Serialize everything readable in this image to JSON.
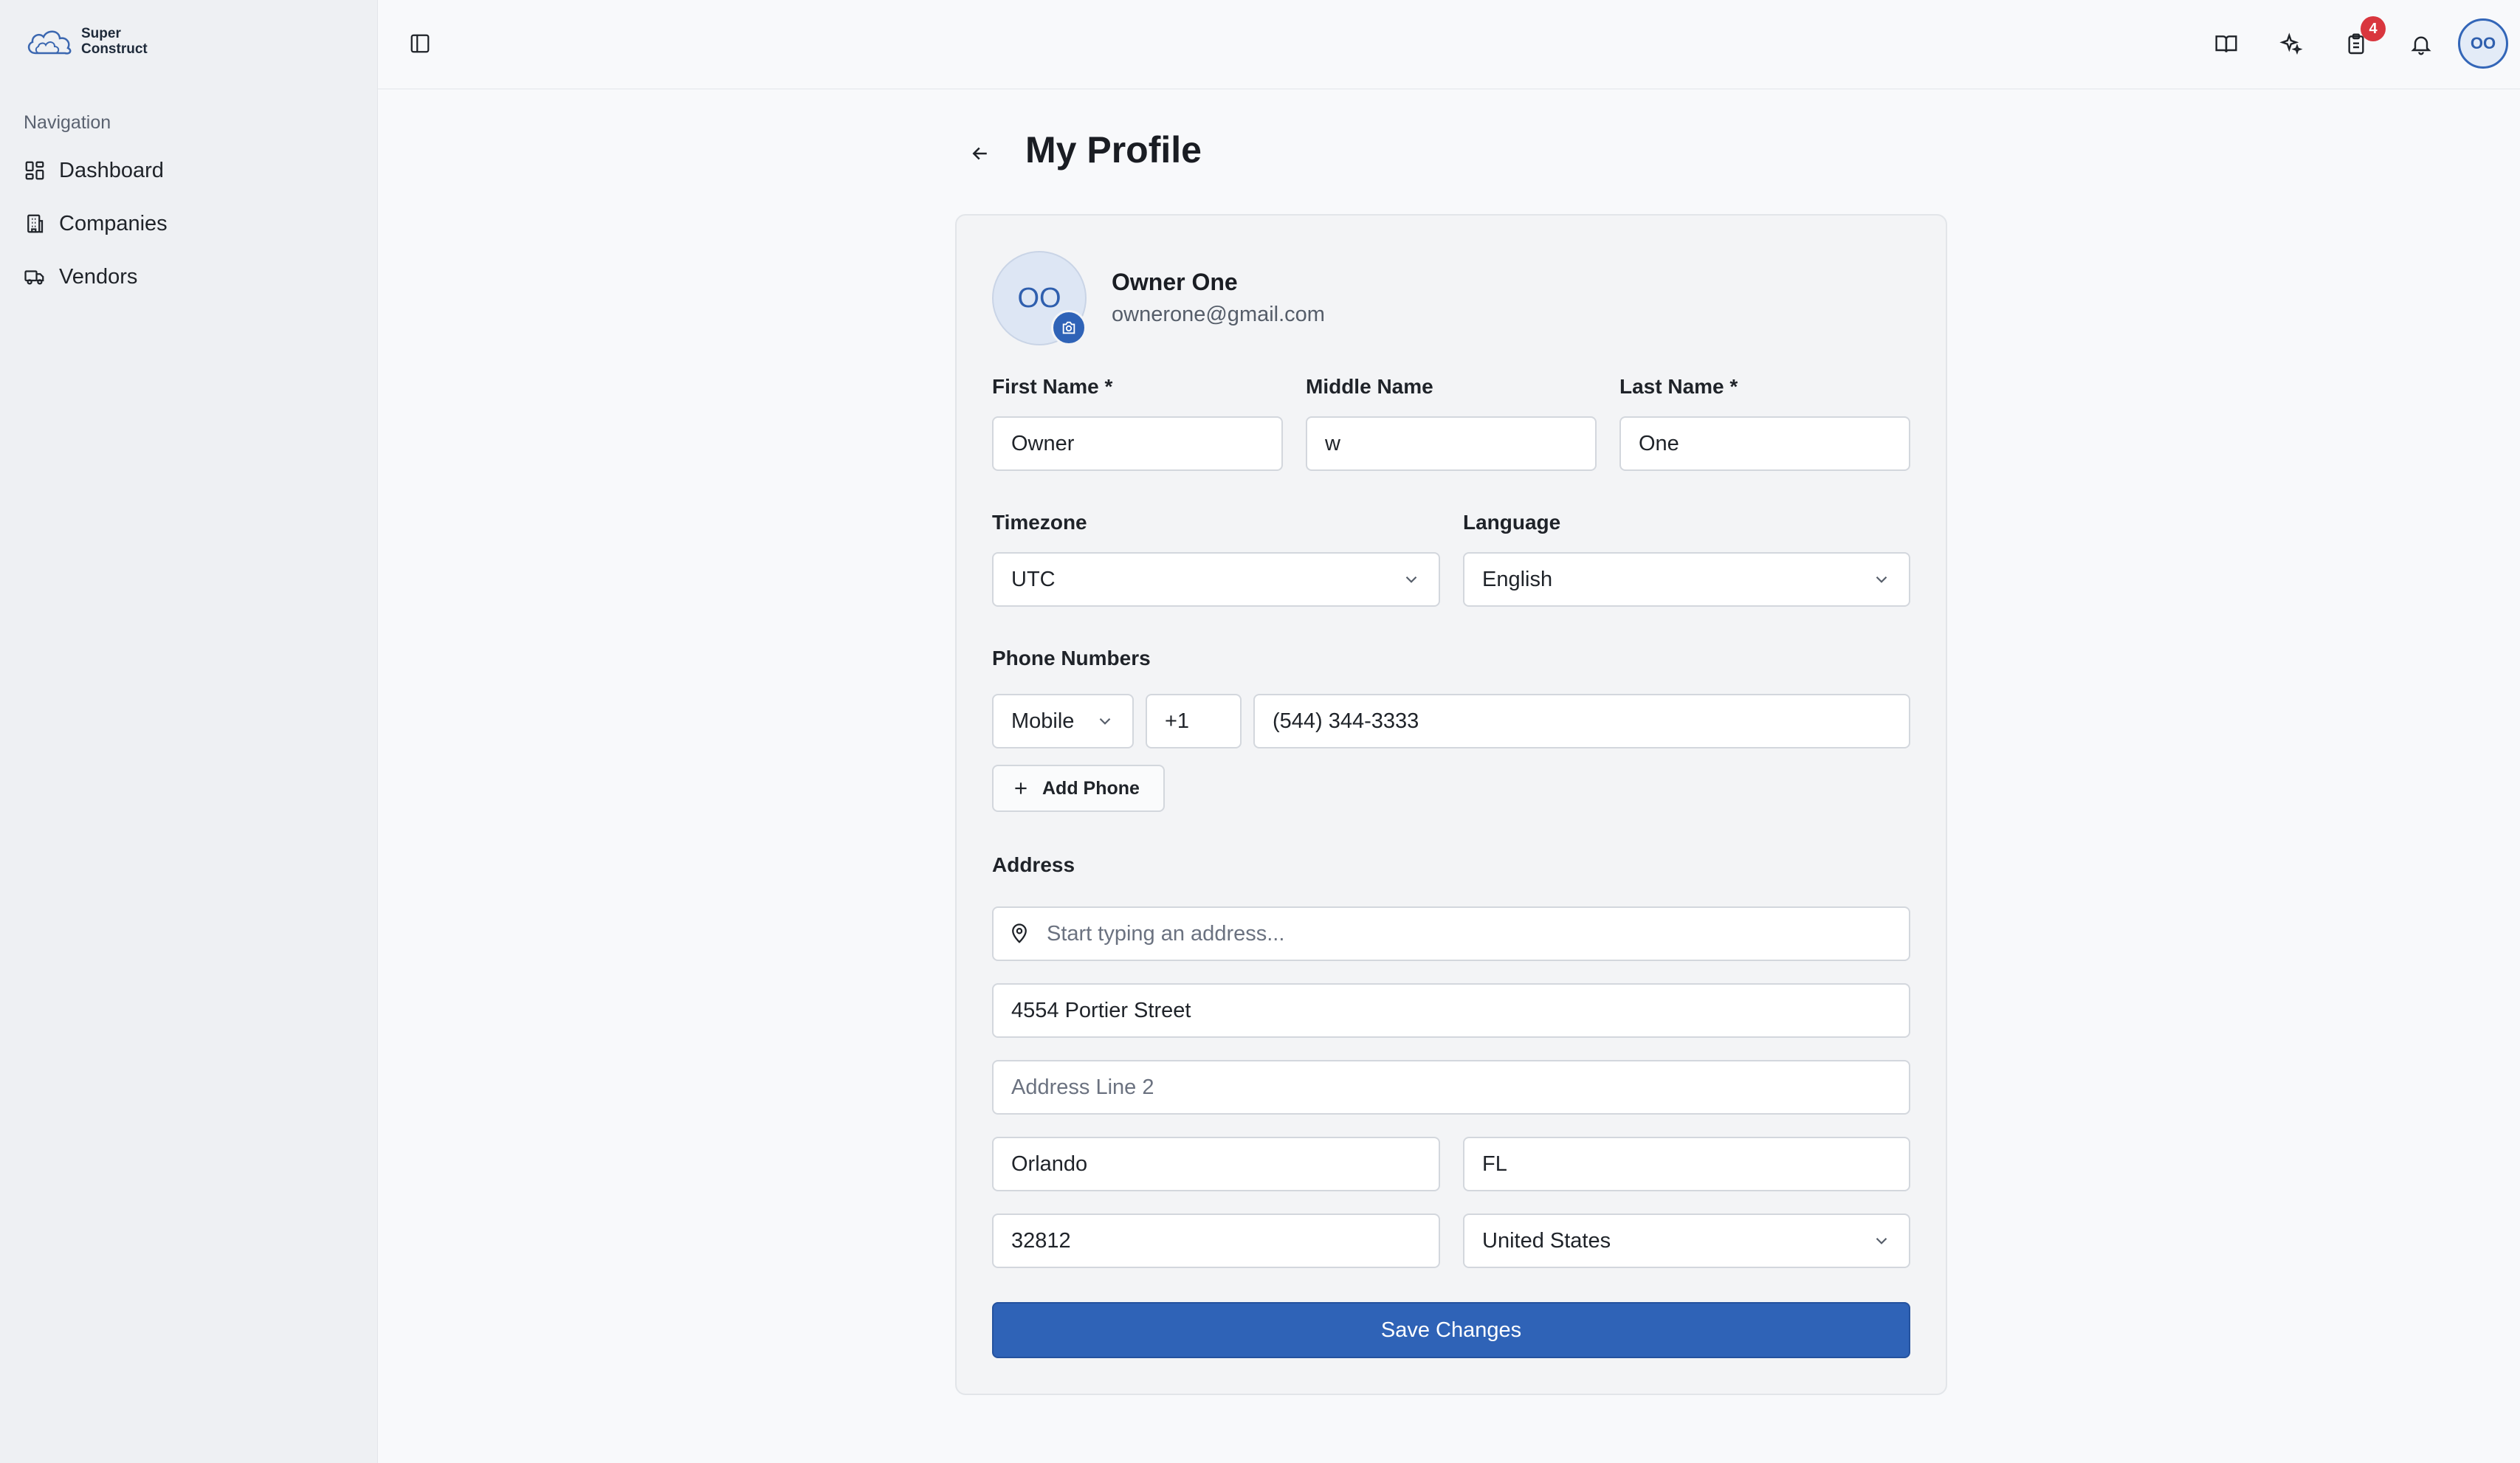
{
  "brand": {
    "line1": "Super",
    "line2": "Construct"
  },
  "sidebar": {
    "heading": "Navigation",
    "items": [
      {
        "label": "Dashboard",
        "icon": "dashboard-icon"
      },
      {
        "label": "Companies",
        "icon": "building-icon"
      },
      {
        "label": "Vendors",
        "icon": "truck-icon"
      }
    ]
  },
  "topbar": {
    "icons": [
      "book-icon",
      "sparkles-icon",
      "clipboard-icon",
      "bell-icon"
    ],
    "task_badge": "4",
    "avatar_initials": "OO"
  },
  "page": {
    "title": "My Profile"
  },
  "profile": {
    "initials": "OO",
    "name": "Owner One",
    "email": "ownerone@gmail.com"
  },
  "form": {
    "first_name_label": "First Name *",
    "first_name": "Owner",
    "middle_name_label": "Middle Name",
    "middle_name": "w",
    "last_name_label": "Last Name *",
    "last_name": "One",
    "timezone_label": "Timezone",
    "timezone": "UTC",
    "language_label": "Language",
    "language": "English",
    "phone_label": "Phone Numbers",
    "phone_type": "Mobile",
    "phone_code": "+1",
    "phone_number": "(544) 344-3333",
    "add_phone": "Add Phone",
    "address_label": "Address",
    "address_search_placeholder": "Start typing an address...",
    "address_line1": "4554 Portier Street",
    "address_line2_placeholder": "Address Line 2",
    "city": "Orlando",
    "state": "FL",
    "zip": "32812",
    "country": "United States",
    "save": "Save Changes"
  },
  "colors": {
    "accent": "#2f63b7",
    "badge": "#d9363e",
    "sidebar_bg": "#eef0f3"
  }
}
